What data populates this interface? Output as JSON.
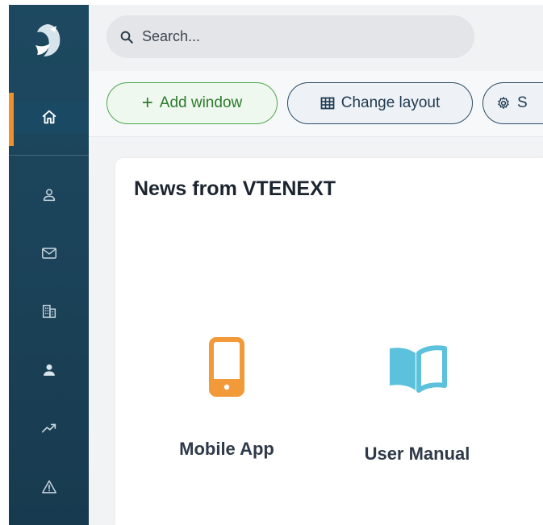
{
  "search": {
    "placeholder": "Search..."
  },
  "toolbar": {
    "add_window_label": "Add window",
    "change_layout_label": "Change layout",
    "settings_label": "S"
  },
  "sidebar": {
    "items": [
      {
        "name": "home",
        "icon": "home-icon",
        "active": true
      },
      {
        "name": "contacts",
        "icon": "person-outline-icon"
      },
      {
        "name": "mail",
        "icon": "mail-icon"
      },
      {
        "name": "companies",
        "icon": "building-icon"
      },
      {
        "name": "users",
        "icon": "person-filled-icon"
      },
      {
        "name": "reports",
        "icon": "trending-up-icon"
      },
      {
        "name": "alerts",
        "icon": "warning-icon"
      }
    ]
  },
  "news": {
    "title": "News from VTENEXT",
    "tiles": [
      {
        "label": "Mobile App",
        "icon": "mobile-phone-icon"
      },
      {
        "label": "User Manual",
        "icon": "open-book-icon"
      }
    ]
  },
  "colors": {
    "sidebar": "#1b4359",
    "accent_orange": "#f0902a",
    "add_green": "#4ea64e",
    "book_blue": "#5cc1dc",
    "phone_orange": "#f29a3a"
  }
}
